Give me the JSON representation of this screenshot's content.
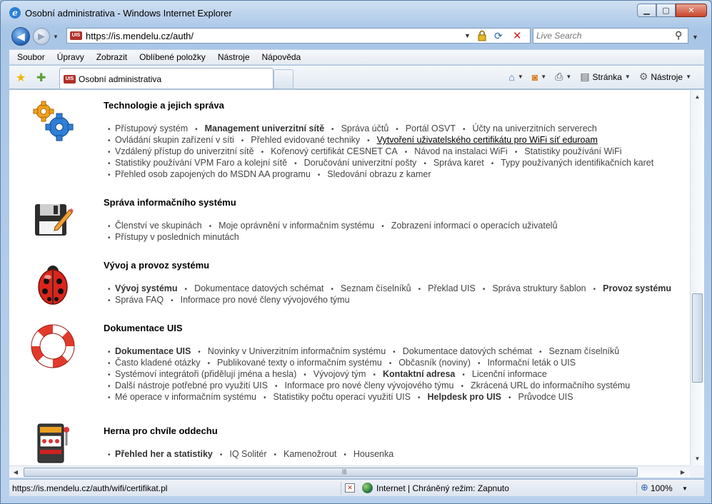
{
  "window": {
    "title": "Osobní administrativa - Windows Internet Explorer",
    "buttons": {
      "minimize": "▁",
      "maximize": "▢",
      "close": "✕"
    }
  },
  "navigation": {
    "favicon_text": "UIS",
    "url": "https://is.mendelu.cz/auth/",
    "search_placeholder": "Live Search"
  },
  "menu": [
    "Soubor",
    "Úpravy",
    "Zobrazit",
    "Oblíbené položky",
    "Nástroje",
    "Nápověda"
  ],
  "tab": {
    "label": "Osobní administrativa"
  },
  "commandbar": {
    "page": "Stránka",
    "tools": "Nástroje"
  },
  "sections": [
    {
      "id": "tech",
      "title": "Technologie a jejich správa",
      "icon": "gears-icon",
      "rows": [
        [
          {
            "t": "Přístupový systém"
          },
          {
            "t": "Management univerzitní sítě",
            "b": true
          },
          {
            "t": "Správa účtů"
          },
          {
            "t": "Portál OSVT"
          },
          {
            "t": "Účty na univerzitních serverech"
          }
        ],
        [
          {
            "t": "Ovládání skupin zařízení v síti"
          },
          {
            "t": "Přehled evidované techniky"
          },
          {
            "t": "Vytvoření uživatelského certifikátu pro WiFi síť eduroam",
            "u": true
          }
        ],
        [
          {
            "t": "Vzdálený přístup do univerzitní sítě"
          },
          {
            "t": "Kořenový certifikát CESNET CA"
          },
          {
            "t": "Návod na instalaci WiFi"
          },
          {
            "t": "Statistiky používání WiFi"
          }
        ],
        [
          {
            "t": "Statistiky používání VPM Faro a kolejní sítě"
          },
          {
            "t": "Doručování univerzitní pošty"
          },
          {
            "t": "Správa karet"
          },
          {
            "t": "Typy používaných identifikačních karet"
          }
        ],
        [
          {
            "t": "Přehled osob zapojených do MSDN AA programu"
          },
          {
            "t": "Sledování obrazu z kamer"
          }
        ]
      ]
    },
    {
      "id": "is",
      "title": "Správa informačního systému",
      "icon": "floppy-pencil-icon",
      "rows": [
        [
          {
            "t": "Členství ve skupinách"
          },
          {
            "t": "Moje oprávnění v informačním systému"
          },
          {
            "t": "Zobrazení informací o operacích uživatelů"
          }
        ],
        [
          {
            "t": "Přístupy v posledních minutách"
          }
        ]
      ]
    },
    {
      "id": "dev",
      "title": "Vývoj a provoz systému",
      "icon": "ladybug-icon",
      "rows": [
        [
          {
            "t": "Vývoj systému",
            "b": true
          },
          {
            "t": "Dokumentace datových schémat"
          },
          {
            "t": "Seznam číselníků"
          },
          {
            "t": "Překlad UIS"
          },
          {
            "t": "Správa struktury šablon"
          },
          {
            "t": "Provoz systému",
            "b": true
          }
        ],
        [
          {
            "t": "Správa FAQ"
          },
          {
            "t": "Informace pro nové členy vývojového týmu"
          }
        ]
      ]
    },
    {
      "id": "doc",
      "title": "Dokumentace UIS",
      "icon": "lifebuoy-icon",
      "rows": [
        [
          {
            "t": "Dokumentace UIS",
            "b": true
          },
          {
            "t": "Novinky v Univerzitním informačním systému"
          },
          {
            "t": "Dokumentace datových schémat"
          },
          {
            "t": "Seznam číselníků"
          }
        ],
        [
          {
            "t": "Často kladené otázky"
          },
          {
            "t": "Publikované texty o informačním systému"
          },
          {
            "t": "Občasník (noviny)"
          },
          {
            "t": "Informační leták o UIS"
          }
        ],
        [
          {
            "t": "Systémoví integrátoři (přidělují jména a hesla)"
          },
          {
            "t": "Vývojový tým"
          },
          {
            "t": "Kontaktní adresa",
            "b": true
          },
          {
            "t": "Licenční informace"
          }
        ],
        [
          {
            "t": "Další nástroje potřebné pro využití UIS"
          },
          {
            "t": "Informace pro nové členy vývojového týmu"
          },
          {
            "t": "Zkrácená URL do informačního systému"
          }
        ],
        [
          {
            "t": "Mé operace v informačním systému"
          },
          {
            "t": "Statistiky počtu operací využití UIS"
          },
          {
            "t": "Helpdesk pro UIS",
            "b": true
          },
          {
            "t": "Průvodce UIS"
          }
        ]
      ]
    },
    {
      "id": "games",
      "title": "Herna pro chvíle oddechu",
      "icon": "slot-machine-icon",
      "rows": [
        [
          {
            "t": "Přehled her a statistiky",
            "b": true
          },
          {
            "t": "IQ Solitér"
          },
          {
            "t": "Kamenožrout"
          },
          {
            "t": "Housenka"
          }
        ]
      ]
    }
  ],
  "statusbar": {
    "url": "https://is.mendelu.cz/auth/wifi/certifikat.pl",
    "zone": "Internet | Chráněný režim: Zapnuto",
    "zoom": "100%"
  }
}
